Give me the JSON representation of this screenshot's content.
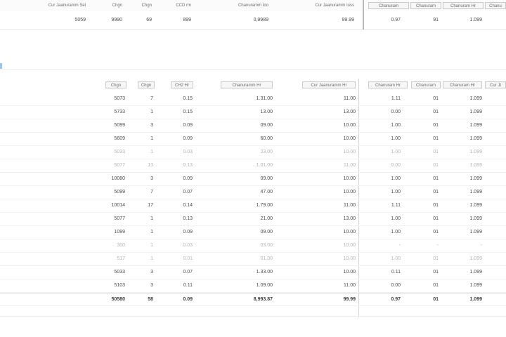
{
  "summary": {
    "headers": [
      "Cur Jaanuramm Sel",
      "Chgn",
      "Chgn",
      "CCD rm",
      "Chanuramm Ioo",
      "Cur Jaanuramm Iuss",
      "Chanuram",
      "Chanuram",
      "Chanuram Hr",
      "Chanu"
    ],
    "row": [
      "5059",
      "9990",
      "69",
      "899",
      "0,9989",
      "99.99",
      "0.97",
      "91",
      "1.099",
      ""
    ]
  },
  "detail": {
    "headers": [
      "Chgn",
      "Chgn",
      "CH2 Hr",
      "Chanuramm Hr",
      "Cur Jaanuramm Hr",
      "Chanuram Hr",
      "Chanuram",
      "Chanuram Hr",
      "Cur Jt"
    ],
    "rows": [
      {
        "cells": [
          "5073",
          "7",
          "0.15",
          "1.31.00",
          "11.00",
          "1.11",
          "01",
          "1.099",
          ""
        ],
        "faded": false
      },
      {
        "cells": [
          "5733",
          "1",
          "0.15",
          "13.00",
          "13.00",
          "0.00",
          "01",
          "1.099",
          ""
        ],
        "faded": false
      },
      {
        "cells": [
          "5099",
          "3",
          "0.09",
          "09.00",
          "10.00",
          "1.00",
          "01",
          "1.099",
          ""
        ],
        "faded": false
      },
      {
        "cells": [
          "5609",
          "1",
          "0.09",
          "60.00",
          "10.00",
          "1.00",
          "01",
          "1.099",
          ""
        ],
        "faded": false
      },
      {
        "cells": [
          "5033",
          "1",
          "0.03",
          "23.00",
          "10.00",
          "1.00",
          "01",
          "1.099",
          ""
        ],
        "faded": true
      },
      {
        "cells": [
          "5077",
          "13",
          "0.13",
          "1.01.00",
          "11.00",
          "0.00",
          "01",
          "1.099",
          ""
        ],
        "faded": true
      },
      {
        "cells": [
          "10080",
          "3",
          "0.09",
          "09.00",
          "10.00",
          "1.00",
          "01",
          "1.099",
          ""
        ],
        "faded": false
      },
      {
        "cells": [
          "5099",
          "7",
          "0.07",
          "47.00",
          "10.00",
          "1.00",
          "01",
          "1.099",
          ""
        ],
        "faded": false
      },
      {
        "cells": [
          "10014",
          "17",
          "0.14",
          "1.79.00",
          "11.00",
          "1.11",
          "01",
          "1.099",
          ""
        ],
        "faded": false
      },
      {
        "cells": [
          "5077",
          "1",
          "0.13",
          "21.00",
          "13.00",
          "1.00",
          "01",
          "1.099",
          ""
        ],
        "faded": false
      },
      {
        "cells": [
          "1099",
          "1",
          "0.09",
          "09.00",
          "10.00",
          "1.00",
          "01",
          "1.099",
          ""
        ],
        "faded": false
      },
      {
        "cells": [
          "300",
          "1",
          "0.03",
          "03.00",
          "10.00",
          "-",
          "-",
          "-",
          ""
        ],
        "faded": true
      },
      {
        "cells": [
          "517",
          "1",
          "0.01",
          "01.00",
          "10.00",
          "1.00",
          "01",
          "1.099",
          ""
        ],
        "faded": true
      },
      {
        "cells": [
          "5033",
          "3",
          "0.07",
          "1.33.00",
          "10.00",
          "0.11",
          "01",
          "1.099",
          ""
        ],
        "faded": false
      },
      {
        "cells": [
          "5103",
          "3",
          "0.11",
          "1.09.00",
          "11.00",
          "0.00",
          "01",
          "1.099",
          ""
        ],
        "faded": false
      }
    ],
    "total": [
      "50580",
      "58",
      "0.09",
      "8,993.87",
      "99.99",
      "0.97",
      "01",
      "1.099",
      ""
    ]
  }
}
